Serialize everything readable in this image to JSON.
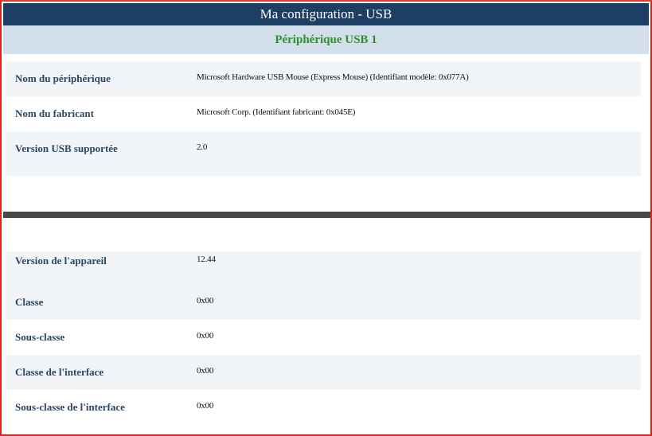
{
  "window": {
    "title": "Ma configuration - USB"
  },
  "section": {
    "title": "Périphérique USB 1"
  },
  "rows_top": [
    {
      "label": "Nom du périphérique",
      "value": "Microsoft Hardware USB Mouse (Express Mouse) (Identifiant modèle: 0x077A)"
    },
    {
      "label": "Nom du fabricant",
      "value": "Microsoft Corp. (Identifiant fabricant: 0x045E)"
    },
    {
      "label": "Version USB supportée",
      "value": "2.0"
    }
  ],
  "rows_bottom": [
    {
      "label": "Version de l'appareil",
      "value": "12.44"
    },
    {
      "label": "Classe",
      "value": "0x00"
    },
    {
      "label": "Sous-classe",
      "value": "0x00"
    },
    {
      "label": "Classe de l'interface",
      "value": "0x00"
    },
    {
      "label": "Sous-classe de l'interface",
      "value": "0x00"
    }
  ],
  "colors": {
    "title_bar": "#1d3f63",
    "section_header_bg": "#d2dfeb",
    "section_header_text": "#2e8f2e",
    "label_text": "#2d4561",
    "frame_border": "#d9261c",
    "divider": "#4a4a4a"
  }
}
